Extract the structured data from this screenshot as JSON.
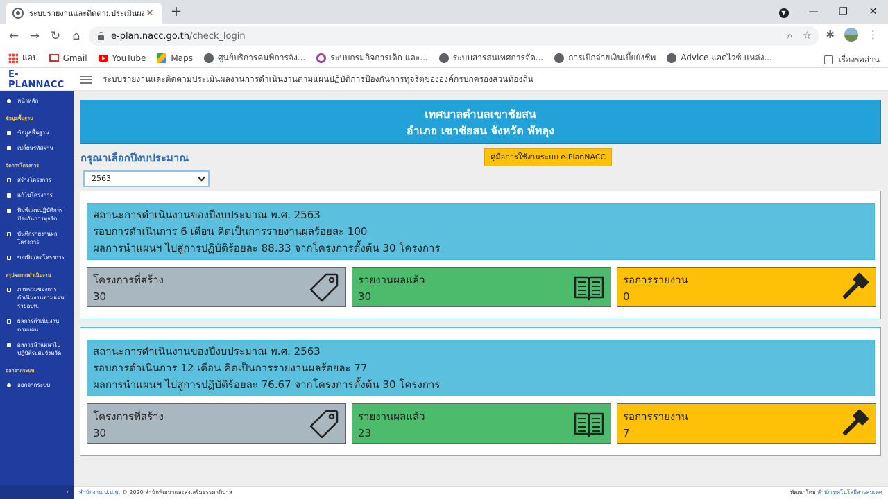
{
  "browser": {
    "tab_title": "ระบบรายงานและติดตามประเมินผลงาน",
    "tab_close": "✕",
    "new_tab": "+",
    "url_host": "e-plan.nacc.go.th",
    "url_path": "/check_login",
    "bookmarks": [
      {
        "label": "แอป",
        "icon": "apps-icon"
      },
      {
        "label": "Gmail",
        "icon": "gmail-icon"
      },
      {
        "label": "YouTube",
        "icon": "youtube-icon"
      },
      {
        "label": "Maps",
        "icon": "maps-icon"
      },
      {
        "label": "ศูนย์บริการคนพิการจัง...",
        "icon": "globe-icon"
      },
      {
        "label": "ระบบกรมกิจการเด็ก และ...",
        "icon": "ring-icon"
      },
      {
        "label": "ระบบสารสนเทศการจัด...",
        "icon": "globe-icon"
      },
      {
        "label": "การเบิกจ่ายเงินเบี้ยยังชีพ",
        "icon": "globe-icon"
      },
      {
        "label": "Advice แอดไวซ์ แหล่ง...",
        "icon": "globe-icon"
      }
    ],
    "reading_list": "เรื่องรออ่าน"
  },
  "app": {
    "brand": "E-PLANNACC",
    "title": "ระบบรายงานและติดตามประเมินผลงานการดำเนินงานตามแผนปฏิบัติการป้องกันการทุจริตขององค์กรปกครองส่วนท้องถิ่น"
  },
  "sidebar": {
    "home": "หน้าหลัก",
    "section_basic": "ข้อมูลพื้นฐาน",
    "basic_info": "ข้อมูลพื้นฐาน",
    "change_password": "เปลี่ยนรหัสผ่าน",
    "section_project": "จัดการโครงการ",
    "create_project": "สร้างโครงการ",
    "edit_project": "แก้ไขโครงการ",
    "print_plan": "พิมพ์แผนปฏิบัติการป้องกันการทุจริต",
    "record_result": "บันทึกรายงานผลโครงการ",
    "request_add": "ขอเพิ่ม/ลดโครงการ",
    "section_summary": "สรุปผลการดำเนินงาน",
    "overview": "ภาพรวมของการดำเนินงานตามแผนรายอปท.",
    "result_plan": "ผลการดำเนินงานตามแผน",
    "result_province": "ผลการนำแผนฯไปปฏิบัติระดับจังหวัด",
    "section_logout": "ออกจากระบบ",
    "logout": "ออกจากระบบ",
    "collapse": "‹"
  },
  "main": {
    "org_line1": "เทศบาลตำบลเขาชัยสน",
    "org_line2": "อำเภอ เขาชัยสน จังหวัด พัทลุง",
    "year_label": "กรุณาเลือกปีงบประมาณ",
    "manual_button": "คู่มือการใช้งานระบบ e-PlanNACC",
    "year_selected": "2563",
    "periods": [
      {
        "line1": "สถานะการดำเนินงานของปีงบประมาณ พ.ศ. 2563",
        "line2": "รอบการดำเนินการ 6 เดือน คิดเป็นการรายงานผลร้อยละ 100",
        "line3": "ผลการนำแผนฯ ไปสู่การปฏิบัติร้อยละ 88.33 จากโครงการตั้งต้น 30 โครงการ",
        "created_label": "โครงการที่สร้าง",
        "created": "30",
        "reported_label": "รายงานผลแล้ว",
        "reported": "30",
        "pending_label": "รอการรายงาน",
        "pending": "0"
      },
      {
        "line1": "สถานะการดำเนินงานของปีงบประมาณ พ.ศ. 2563",
        "line2": "รอบการดำเนินการ 12 เดือน คิดเป็นการรายงานผลร้อยละ 77",
        "line3": "ผลการนำแผนฯ ไปสู่การปฏิบัติร้อยละ 76.67 จากโครงการตั้งต้น 30 โครงการ",
        "created_label": "โครงการที่สร้าง",
        "created": "30",
        "reported_label": "รายงานผลแล้ว",
        "reported": "23",
        "pending_label": "รอการรายงาน",
        "pending": "7"
      }
    ]
  },
  "footer": {
    "left_link": "สำนักงาน ป.ป.ช.",
    "left_text": "© 2020 สำนักพัฒนาและส่งเสริมธรรมาภิบาล",
    "right_text": "พัฒนาโดย",
    "right_link": "สำนักเทคโนโลยีสารสนเทศ"
  },
  "colors": {
    "sidebar": "#1e3d9e",
    "org_header": "#22a2d8",
    "status_box": "#5bc0de",
    "card_created": "#a9b7c0",
    "card_reported": "#4dbb6c",
    "card_pending": "#ffc107"
  }
}
